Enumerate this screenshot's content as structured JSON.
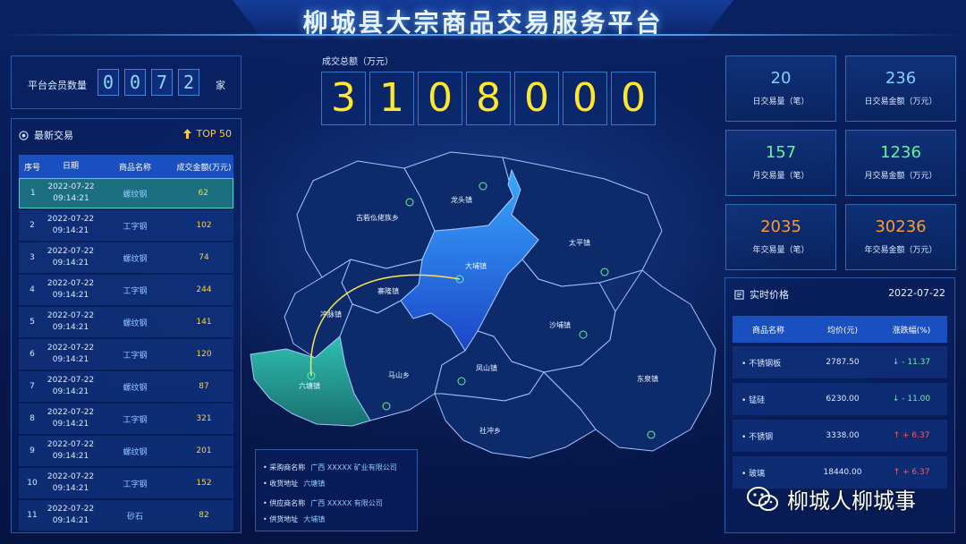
{
  "header": {
    "title": "柳城县大宗商品交易服务平台"
  },
  "members": {
    "label": "平台会员数量",
    "digits": [
      "0",
      "0",
      "7",
      "2"
    ],
    "unit": "家"
  },
  "latest": {
    "title": "最新交易",
    "top_label": "TOP 50",
    "columns": [
      "序号",
      "日期",
      "商品名称",
      "成交金额(万元)"
    ],
    "rows": [
      {
        "idx": "1",
        "date": "2022-07-22",
        "time": "09:14:21",
        "name": "螺纹钢",
        "amount": "62"
      },
      {
        "idx": "2",
        "date": "2022-07-22",
        "time": "09:14:21",
        "name": "工字钢",
        "amount": "102"
      },
      {
        "idx": "3",
        "date": "2022-07-22",
        "time": "09:14:21",
        "name": "螺纹钢",
        "amount": "74"
      },
      {
        "idx": "4",
        "date": "2022-07-22",
        "time": "09:14:21",
        "name": "工字钢",
        "amount": "244"
      },
      {
        "idx": "5",
        "date": "2022-07-22",
        "time": "09:14:21",
        "name": "螺纹钢",
        "amount": "141"
      },
      {
        "idx": "6",
        "date": "2022-07-22",
        "time": "09:14:21",
        "name": "工字钢",
        "amount": "120"
      },
      {
        "idx": "7",
        "date": "2022-07-22",
        "time": "09:14:21",
        "name": "螺纹钢",
        "amount": "87"
      },
      {
        "idx": "8",
        "date": "2022-07-22",
        "time": "09:14:21",
        "name": "工字钢",
        "amount": "321"
      },
      {
        "idx": "9",
        "date": "2022-07-22",
        "time": "09:14:21",
        "name": "螺纹钢",
        "amount": "201"
      },
      {
        "idx": "10",
        "date": "2022-07-22",
        "time": "09:14:21",
        "name": "工字钢",
        "amount": "152"
      },
      {
        "idx": "11",
        "date": "2022-07-22",
        "time": "09:14:21",
        "name": "砂石",
        "amount": "82"
      }
    ]
  },
  "total": {
    "label": "成交总额（万元）",
    "digits": [
      "3",
      "1",
      "0",
      "8",
      "0",
      "0",
      "0"
    ]
  },
  "stats": [
    {
      "value": "20",
      "label": "日交易量（笔）",
      "color": "#7fd0ff"
    },
    {
      "value": "236",
      "label": "日交易金额（万元）",
      "color": "#7fd0ff"
    },
    {
      "value": "157",
      "label": "月交易量（笔）",
      "color": "#5ef59a"
    },
    {
      "value": "1236",
      "label": "月交易金额（万元）",
      "color": "#5ef59a"
    },
    {
      "value": "2035",
      "label": "年交易量（笔）",
      "color": "#ff9a2a"
    },
    {
      "value": "30236",
      "label": "年交易金额（万元）",
      "color": "#ff9a2a"
    }
  ],
  "prices": {
    "title": "实时价格",
    "date": "2022-07-22",
    "columns": [
      "商品名称",
      "均价(元)",
      "涨跌幅(%)"
    ],
    "rows": [
      {
        "name": "• 不锈钢板",
        "avg": "2787.50",
        "arrow": "↓",
        "change": "- 11.37",
        "color": "#5ef59a"
      },
      {
        "name": "• 锰硅",
        "avg": "6230.00",
        "arrow": "↓",
        "change": "- 11.00",
        "color": "#5ef59a"
      },
      {
        "name": "• 不锈钢",
        "avg": "3338.00",
        "arrow": "↑",
        "change": "+ 6.37",
        "color": "#ff5a5a"
      },
      {
        "name": "• 玻璃",
        "avg": "18440.00",
        "arrow": "↑",
        "change": "+ 6.37",
        "color": "#ff5a5a"
      }
    ]
  },
  "map": {
    "towns": [
      "古砦仫佬族乡",
      "龙头镇",
      "太平镇",
      "大埔镇",
      "寨隆镇",
      "冲脉镇",
      "沙埔镇",
      "六塘镇",
      "马山乡",
      "凤山镇",
      "东泉镇",
      "社冲乡"
    ]
  },
  "info": {
    "rows": [
      {
        "label": "• 采购商名称",
        "value": "广西 XXXXX 矿业有限公司"
      },
      {
        "label": "• 收货地址",
        "value": "六塘镇"
      },
      {
        "label": "• 供应商名称",
        "value": "广西 XXXXX 有限公司"
      },
      {
        "label": "• 供货地址",
        "value": "大埔镇"
      }
    ]
  },
  "watermark": {
    "text": "柳城人柳城事"
  }
}
